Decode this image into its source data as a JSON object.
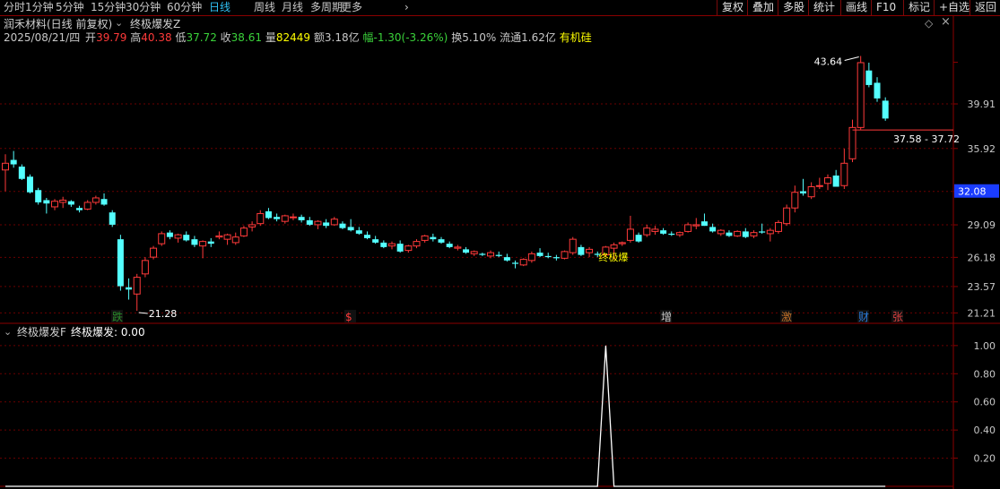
{
  "periods": [
    "分时",
    "1分钟",
    "5分钟",
    "15分钟",
    "30分钟",
    "60分钟",
    "日线",
    "周线",
    "月线",
    "多周期",
    "更多"
  ],
  "period_active": "日线",
  "tools": [
    "复权",
    "叠加",
    "多股",
    "统计",
    "画线",
    "F10",
    "标记",
    "+自选",
    "返回"
  ],
  "stock_title": "润禾材料(日线 前复权)",
  "indicator_name": "终极爆发Z",
  "quote": {
    "date": "2025/08/21/四",
    "open_label": "开",
    "open": "39.79",
    "high_label": "高",
    "high": "40.38",
    "low_label": "低",
    "low": "37.72",
    "close_label": "收",
    "close": "38.61",
    "vol_label": "量",
    "vol": "82449",
    "amount_label": "额",
    "amount": "3.18亿",
    "chg_label": "幅",
    "chg": "-1.30(-3.26%)",
    "turnover_label": "换",
    "turnover": "5.10%",
    "float_label": "流通",
    "float": "1.62亿",
    "concept": "有机硅"
  },
  "colors": {
    "up": "#ff3a3a",
    "down": "#54ffff",
    "grid": "#6b0000",
    "axis": "#8b0000",
    "text": "#c8c8c8",
    "yellow": "#ffff00",
    "white": "#ffffff",
    "price_tag": "#1a3cff"
  },
  "price_axis": {
    "ticks": [
      "43.64",
      "39.91",
      "35.92",
      "32.08",
      "29.09",
      "26.18",
      "23.57",
      "21.21"
    ],
    "current_price": "32.08"
  },
  "annotations": {
    "high_label": "43.64",
    "low_label": "21.28",
    "range_label": "37.58 - 37.72",
    "signal_text": "终极爆"
  },
  "event_markers": [
    {
      "label": "跌",
      "color": "#2a8a2a"
    },
    {
      "label": "$",
      "color": "#ff3a3a"
    },
    {
      "label": "增",
      "color": "#c8c8c8"
    },
    {
      "label": "激",
      "color": "#c07028"
    },
    {
      "label": "财",
      "color": "#2a7ad8"
    },
    {
      "label": "张",
      "color": "#d84040"
    }
  ],
  "sub_indicator": {
    "title": "终极爆发F",
    "value_label": "终极爆发: 0.00",
    "ticks": [
      "1.00",
      "0.80",
      "0.60",
      "0.40",
      "0.20"
    ]
  },
  "chart_data": {
    "type": "candlestick",
    "ylim": [
      20.6,
      45.2
    ],
    "candles": [
      [
        34.0,
        35.4,
        32.1,
        34.6
      ],
      [
        34.9,
        35.7,
        34.2,
        34.5
      ],
      [
        34.3,
        34.5,
        33.1,
        33.2
      ],
      [
        33.4,
        33.6,
        31.9,
        32.0
      ],
      [
        32.2,
        32.4,
        30.9,
        31.1
      ],
      [
        31.3,
        31.5,
        30.1,
        31.0
      ],
      [
        30.7,
        31.4,
        30.4,
        31.2
      ],
      [
        31.1,
        31.6,
        30.6,
        31.3
      ],
      [
        31.2,
        31.3,
        30.7,
        30.9
      ],
      [
        30.6,
        30.8,
        30.2,
        30.4
      ],
      [
        30.5,
        31.3,
        30.4,
        31.1
      ],
      [
        31.1,
        31.7,
        30.9,
        31.5
      ],
      [
        31.4,
        31.9,
        30.8,
        30.9
      ],
      [
        30.2,
        30.4,
        28.9,
        29.1
      ],
      [
        27.8,
        28.2,
        23.2,
        23.6
      ],
      [
        23.5,
        24.3,
        22.4,
        23.3
      ],
      [
        22.9,
        24.7,
        21.4,
        24.4
      ],
      [
        24.7,
        26.2,
        24.4,
        25.9
      ],
      [
        26.2,
        27.2,
        26.0,
        27.0
      ],
      [
        27.4,
        28.5,
        27.2,
        28.3
      ],
      [
        28.4,
        28.6,
        27.8,
        28.0
      ],
      [
        27.9,
        28.3,
        27.5,
        28.2
      ],
      [
        28.2,
        28.5,
        27.6,
        27.7
      ],
      [
        27.8,
        28.1,
        27.1,
        27.3
      ],
      [
        27.2,
        27.7,
        26.1,
        27.6
      ],
      [
        27.6,
        27.9,
        27.1,
        27.4
      ],
      [
        28.0,
        28.5,
        27.8,
        28.1
      ],
      [
        27.8,
        28.3,
        27.3,
        28.2
      ],
      [
        27.5,
        28.4,
        27.3,
        28.0
      ],
      [
        28.1,
        29.0,
        28.0,
        28.8
      ],
      [
        28.9,
        29.4,
        28.5,
        29.1
      ],
      [
        29.2,
        30.4,
        29.0,
        30.1
      ],
      [
        30.3,
        30.6,
        29.6,
        29.7
      ],
      [
        29.8,
        30.1,
        29.4,
        29.6
      ],
      [
        29.4,
        30.0,
        29.2,
        29.9
      ],
      [
        29.8,
        30.1,
        29.5,
        29.8
      ],
      [
        29.8,
        30.0,
        29.3,
        29.5
      ],
      [
        29.5,
        29.8,
        29.0,
        29.1
      ],
      [
        29.1,
        29.5,
        28.7,
        29.4
      ],
      [
        29.3,
        29.6,
        28.8,
        29.0
      ],
      [
        29.1,
        29.8,
        29.0,
        29.6
      ],
      [
        29.2,
        29.4,
        28.7,
        28.8
      ],
      [
        28.9,
        29.6,
        28.5,
        28.6
      ],
      [
        28.6,
        28.9,
        28.2,
        28.3
      ],
      [
        28.2,
        28.5,
        27.8,
        27.9
      ],
      [
        27.8,
        28.1,
        27.4,
        27.5
      ],
      [
        27.5,
        27.7,
        27.0,
        27.1
      ],
      [
        27.2,
        27.6,
        26.9,
        27.4
      ],
      [
        27.4,
        27.7,
        26.6,
        26.7
      ],
      [
        26.8,
        27.3,
        26.6,
        27.2
      ],
      [
        27.2,
        27.8,
        27.0,
        27.6
      ],
      [
        27.7,
        28.2,
        27.5,
        28.1
      ],
      [
        28.0,
        28.3,
        27.6,
        27.8
      ],
      [
        27.8,
        28.0,
        27.4,
        27.5
      ],
      [
        27.4,
        27.6,
        27.0,
        27.1
      ],
      [
        27.0,
        27.3,
        26.8,
        27.1
      ],
      [
        26.9,
        27.1,
        26.5,
        26.6
      ],
      [
        26.5,
        26.8,
        26.3,
        26.7
      ],
      [
        26.5,
        26.6,
        26.3,
        26.4
      ],
      [
        26.3,
        26.8,
        26.1,
        26.6
      ],
      [
        26.4,
        26.7,
        26.2,
        26.3
      ],
      [
        26.2,
        26.5,
        25.8,
        25.9
      ],
      [
        25.7,
        25.9,
        25.2,
        25.6
      ],
      [
        25.5,
        26.1,
        25.4,
        26.0
      ],
      [
        25.9,
        26.7,
        25.7,
        26.5
      ],
      [
        26.6,
        27.0,
        26.2,
        26.3
      ],
      [
        26.3,
        26.6,
        26.1,
        26.2
      ],
      [
        26.2,
        26.4,
        25.9,
        26.1
      ],
      [
        26.1,
        26.8,
        26.0,
        26.7
      ],
      [
        26.6,
        28.0,
        26.4,
        27.8
      ],
      [
        27.1,
        27.3,
        26.3,
        26.4
      ],
      [
        26.6,
        27.1,
        26.2,
        26.9
      ],
      [
        26.5,
        26.7,
        26.2,
        26.4
      ],
      [
        26.4,
        27.2,
        26.3,
        27.1
      ],
      [
        27.0,
        27.5,
        26.0,
        27.3
      ],
      [
        27.4,
        27.6,
        27.2,
        27.5
      ],
      [
        27.7,
        29.9,
        27.5,
        28.7
      ],
      [
        28.2,
        28.4,
        27.5,
        27.6
      ],
      [
        28.2,
        29.1,
        28.0,
        28.8
      ],
      [
        28.5,
        29.0,
        28.2,
        28.7
      ],
      [
        28.6,
        28.8,
        28.2,
        28.3
      ],
      [
        28.3,
        28.5,
        28.1,
        28.2
      ],
      [
        28.2,
        28.5,
        28.0,
        28.4
      ],
      [
        28.5,
        29.3,
        28.4,
        29.1
      ],
      [
        29.0,
        29.7,
        28.7,
        29.1
      ],
      [
        29.4,
        30.1,
        29.0,
        29.0
      ],
      [
        28.9,
        29.2,
        28.4,
        28.5
      ],
      [
        28.3,
        28.7,
        28.1,
        28.6
      ],
      [
        28.4,
        28.6,
        28.0,
        28.1
      ],
      [
        28.1,
        28.6,
        28.0,
        28.5
      ],
      [
        28.5,
        28.8,
        27.9,
        28.0
      ],
      [
        28.1,
        28.6,
        27.9,
        28.4
      ],
      [
        28.5,
        29.2,
        28.3,
        28.4
      ],
      [
        28.3,
        28.8,
        27.6,
        28.6
      ],
      [
        28.5,
        29.5,
        28.3,
        29.3
      ],
      [
        29.2,
        30.9,
        29.0,
        30.6
      ],
      [
        30.6,
        32.6,
        30.2,
        32.0
      ],
      [
        32.1,
        33.2,
        31.7,
        31.9
      ],
      [
        31.6,
        32.9,
        31.4,
        32.5
      ],
      [
        32.6,
        33.3,
        32.3,
        32.6
      ],
      [
        32.8,
        33.6,
        32.2,
        33.3
      ],
      [
        33.5,
        34.0,
        32.7,
        32.5
      ],
      [
        32.6,
        35.9,
        32.3,
        34.6
      ],
      [
        35.0,
        38.5,
        34.7,
        37.8
      ],
      [
        37.8,
        44.2,
        37.6,
        43.6
      ],
      [
        42.9,
        43.6,
        41.4,
        41.6
      ],
      [
        41.8,
        42.3,
        40.1,
        40.4
      ],
      [
        40.2,
        40.5,
        38.4,
        38.6
      ]
    ],
    "sub_values_note": "single spike at signal day",
    "sub_spike_index": 73,
    "sub_ylim": [
      0,
      1.05
    ]
  }
}
